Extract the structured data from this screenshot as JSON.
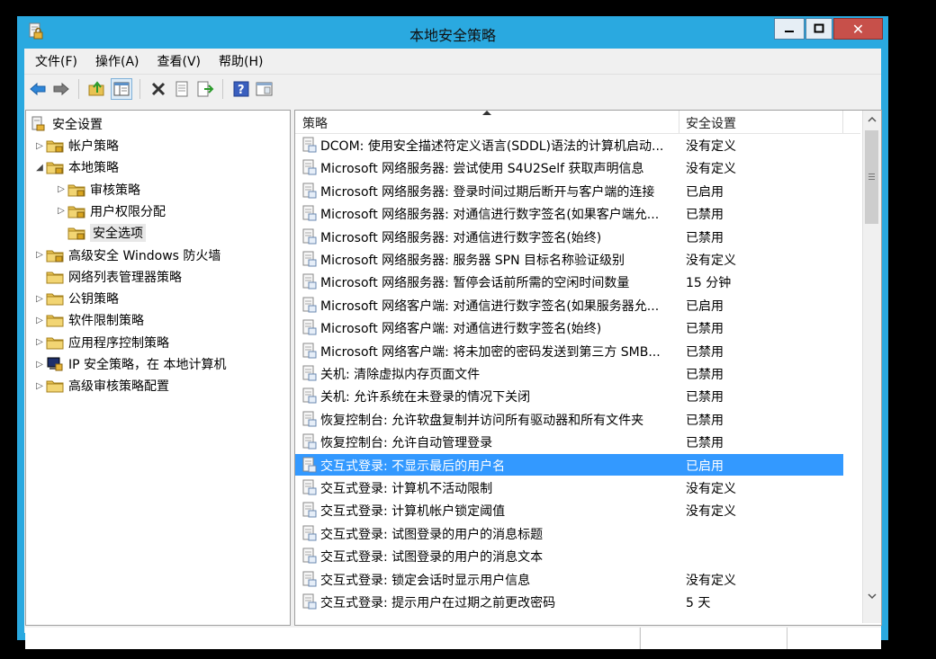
{
  "window": {
    "title": "本地安全策略"
  },
  "menu": [
    {
      "label": "文件(F)",
      "name": "menu-file"
    },
    {
      "label": "操作(A)",
      "name": "menu-action"
    },
    {
      "label": "查看(V)",
      "name": "menu-view"
    },
    {
      "label": "帮助(H)",
      "name": "menu-help"
    }
  ],
  "toolbar": {
    "icons": [
      "back-arrow-icon",
      "forward-arrow-icon",
      "up-folder-icon",
      "show-hide-tree-icon",
      "delete-icon",
      "properties-icon",
      "export-list-icon",
      "help-icon",
      "console-view-icon"
    ]
  },
  "tree": {
    "root": "安全设置",
    "nodes": [
      {
        "label": "帐户策略",
        "name": "tree-account-policies",
        "expander": "collapsed",
        "level": 1
      },
      {
        "label": "本地策略",
        "name": "tree-local-policies",
        "expander": "expanded",
        "level": 1
      },
      {
        "label": "审核策略",
        "name": "tree-audit-policy",
        "expander": "collapsed",
        "level": 2
      },
      {
        "label": "用户权限分配",
        "name": "tree-user-rights",
        "expander": "collapsed",
        "level": 2
      },
      {
        "label": "安全选项",
        "name": "tree-security-options",
        "expander": "none",
        "level": 2,
        "selected": true
      },
      {
        "label": "高级安全 Windows 防火墙",
        "name": "tree-firewall",
        "expander": "collapsed",
        "level": 1
      },
      {
        "label": "网络列表管理器策略",
        "name": "tree-network-list",
        "expander": "none",
        "level": 1
      },
      {
        "label": "公钥策略",
        "name": "tree-public-key",
        "expander": "collapsed",
        "level": 1
      },
      {
        "label": "软件限制策略",
        "name": "tree-software-restriction",
        "expander": "collapsed",
        "level": 1
      },
      {
        "label": "应用程序控制策略",
        "name": "tree-app-control",
        "expander": "collapsed",
        "level": 1
      },
      {
        "label": "IP 安全策略，在 本地计算机",
        "name": "tree-ipsec",
        "expander": "collapsed",
        "level": 1,
        "icon": "ipsec"
      },
      {
        "label": "高级审核策略配置",
        "name": "tree-advanced-audit",
        "expander": "collapsed",
        "level": 1
      }
    ]
  },
  "list": {
    "col_policy": "策略",
    "col_setting": "安全设置",
    "rows": [
      {
        "policy": "DCOM: 使用安全描述符定义语言(SDDL)语法的计算机启动...",
        "setting": "没有定义"
      },
      {
        "policy": "Microsoft 网络服务器: 尝试使用 S4U2Self 获取声明信息",
        "setting": "没有定义"
      },
      {
        "policy": "Microsoft 网络服务器: 登录时间过期后断开与客户端的连接",
        "setting": "已启用"
      },
      {
        "policy": "Microsoft 网络服务器: 对通信进行数字签名(如果客户端允...",
        "setting": "已禁用"
      },
      {
        "policy": "Microsoft 网络服务器: 对通信进行数字签名(始终)",
        "setting": "已禁用"
      },
      {
        "policy": "Microsoft 网络服务器: 服务器 SPN 目标名称验证级别",
        "setting": "没有定义"
      },
      {
        "policy": "Microsoft 网络服务器: 暂停会话前所需的空闲时间数量",
        "setting": "15 分钟"
      },
      {
        "policy": "Microsoft 网络客户端: 对通信进行数字签名(如果服务器允...",
        "setting": "已启用"
      },
      {
        "policy": "Microsoft 网络客户端: 对通信进行数字签名(始终)",
        "setting": "已禁用"
      },
      {
        "policy": "Microsoft 网络客户端: 将未加密的密码发送到第三方 SMB...",
        "setting": "已禁用"
      },
      {
        "policy": "关机: 清除虚拟内存页面文件",
        "setting": "已禁用"
      },
      {
        "policy": "关机: 允许系统在未登录的情况下关闭",
        "setting": "已禁用"
      },
      {
        "policy": "恢复控制台: 允许软盘复制并访问所有驱动器和所有文件夹",
        "setting": "已禁用"
      },
      {
        "policy": "恢复控制台: 允许自动管理登录",
        "setting": "已禁用"
      },
      {
        "policy": "交互式登录: 不显示最后的用户名",
        "setting": "已启用",
        "selected": true
      },
      {
        "policy": "交互式登录: 计算机不活动限制",
        "setting": "没有定义"
      },
      {
        "policy": "交互式登录: 计算机帐户锁定阈值",
        "setting": "没有定义"
      },
      {
        "policy": "交互式登录: 试图登录的用户的消息标题",
        "setting": ""
      },
      {
        "policy": "交互式登录: 试图登录的用户的消息文本",
        "setting": ""
      },
      {
        "policy": "交互式登录: 锁定会话时显示用户信息",
        "setting": "没有定义"
      },
      {
        "policy": "交互式登录: 提示用户在过期之前更改密码",
        "setting": "5 天"
      }
    ]
  },
  "colors": {
    "window_frame": "#2aa9e0",
    "selection": "#3399ff"
  }
}
